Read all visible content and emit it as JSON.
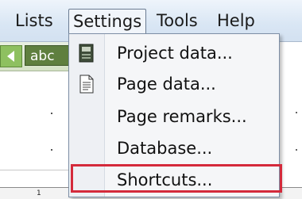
{
  "menubar": {
    "items": [
      {
        "label": "Lists"
      },
      {
        "label": "Settings"
      },
      {
        "label": "Tools"
      },
      {
        "label": "Help"
      }
    ]
  },
  "toolbar": {
    "back_icon": "arrow-left-icon",
    "abc_label": "abc"
  },
  "ruler": {
    "number": "1"
  },
  "settings_menu": {
    "items": [
      {
        "label": "Project data...",
        "icon": "project-data-icon"
      },
      {
        "label": "Page data...",
        "icon": "page-document-icon"
      },
      {
        "label": "Page remarks..."
      },
      {
        "label": "Database..."
      },
      {
        "label": "Shortcuts...",
        "highlighted": true
      }
    ]
  },
  "colors": {
    "highlight_border": "#d42a3b",
    "menubar_bg": "#d9e6f4"
  }
}
